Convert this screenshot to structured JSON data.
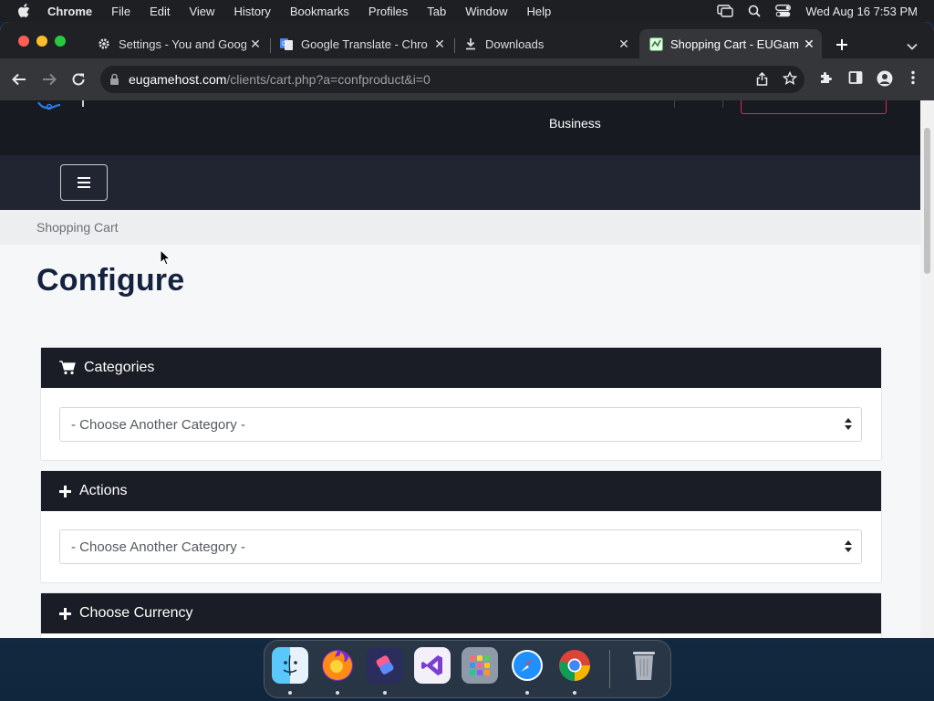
{
  "menubar": {
    "app": "Chrome",
    "items": [
      "File",
      "Edit",
      "View",
      "History",
      "Bookmarks",
      "Profiles",
      "Tab",
      "Window",
      "Help"
    ],
    "datetime": "Wed Aug 16  7:53 PM"
  },
  "tabs": [
    {
      "title": "Settings - You and Goog",
      "icon": "gear-icon"
    },
    {
      "title": "Google Translate - Chro",
      "icon": "translate-icon"
    },
    {
      "title": "Downloads",
      "icon": "download-icon"
    },
    {
      "title": "Shopping Cart - EUGam",
      "icon": "site-favicon"
    }
  ],
  "address": {
    "host": "eugamehost.com",
    "path": "/clients/cart.php?a=confproduct&i=0"
  },
  "site": {
    "header_link": "Business",
    "breadcrumb": "Shopping Cart",
    "page_title": "Configure"
  },
  "panels": [
    {
      "title": "Categories",
      "icon": "cart-icon",
      "select_value": "- Choose Another Category -"
    },
    {
      "title": "Actions",
      "icon": "plus-icon",
      "select_value": "- Choose Another Category -"
    },
    {
      "title": "Choose Currency",
      "icon": "plus-icon"
    }
  ],
  "dock": {
    "apps": [
      "Finder",
      "Firefox",
      "Shortcuts",
      "Visual Studio",
      "Launchpad",
      "Safari",
      "Chrome",
      "Trash"
    ]
  },
  "colors": {
    "header_dark": "#181a21",
    "nav_dark": "#212531",
    "panel_head": "#1b1d26",
    "title_navy": "#15223f",
    "accent_pink": "#e0245e"
  }
}
